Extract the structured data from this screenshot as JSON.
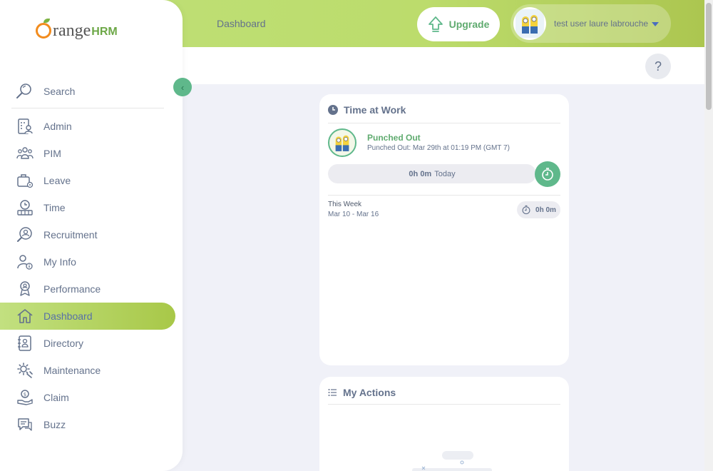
{
  "header": {
    "breadcrumb": "Dashboard",
    "upgrade_label": "Upgrade",
    "user_name": "test user laure labrouche"
  },
  "help": {
    "label": "?"
  },
  "brand": {
    "word": "range",
    "suffix": "HRM"
  },
  "sidebar": {
    "search_label": "Search",
    "items": [
      {
        "label": "Admin",
        "icon": "admin-icon"
      },
      {
        "label": "PIM",
        "icon": "pim-icon"
      },
      {
        "label": "Leave",
        "icon": "leave-icon"
      },
      {
        "label": "Time",
        "icon": "time-icon"
      },
      {
        "label": "Recruitment",
        "icon": "recruitment-icon"
      },
      {
        "label": "My Info",
        "icon": "my-info-icon"
      },
      {
        "label": "Performance",
        "icon": "performance-icon"
      },
      {
        "label": "Dashboard",
        "icon": "dashboard-icon",
        "active": true
      },
      {
        "label": "Directory",
        "icon": "directory-icon"
      },
      {
        "label": "Maintenance",
        "icon": "maintenance-icon"
      },
      {
        "label": "Claim",
        "icon": "claim-icon"
      },
      {
        "label": "Buzz",
        "icon": "buzz-icon"
      }
    ]
  },
  "time_at_work": {
    "title": "Time at Work",
    "status": "Punched Out",
    "detail": "Punched Out: Mar 29th at 01:19 PM (GMT 7)",
    "today_value": "0h 0m",
    "today_label": "Today",
    "week_label": "This Week",
    "week_range": "Mar 10 - Mar 16",
    "week_total": "0h 0m"
  },
  "my_actions": {
    "title": "My Actions"
  },
  "colors": {
    "brand_green": "#5fb88b",
    "active_gradient_start": "#c2e080",
    "active_gradient_end": "#a8c848"
  }
}
